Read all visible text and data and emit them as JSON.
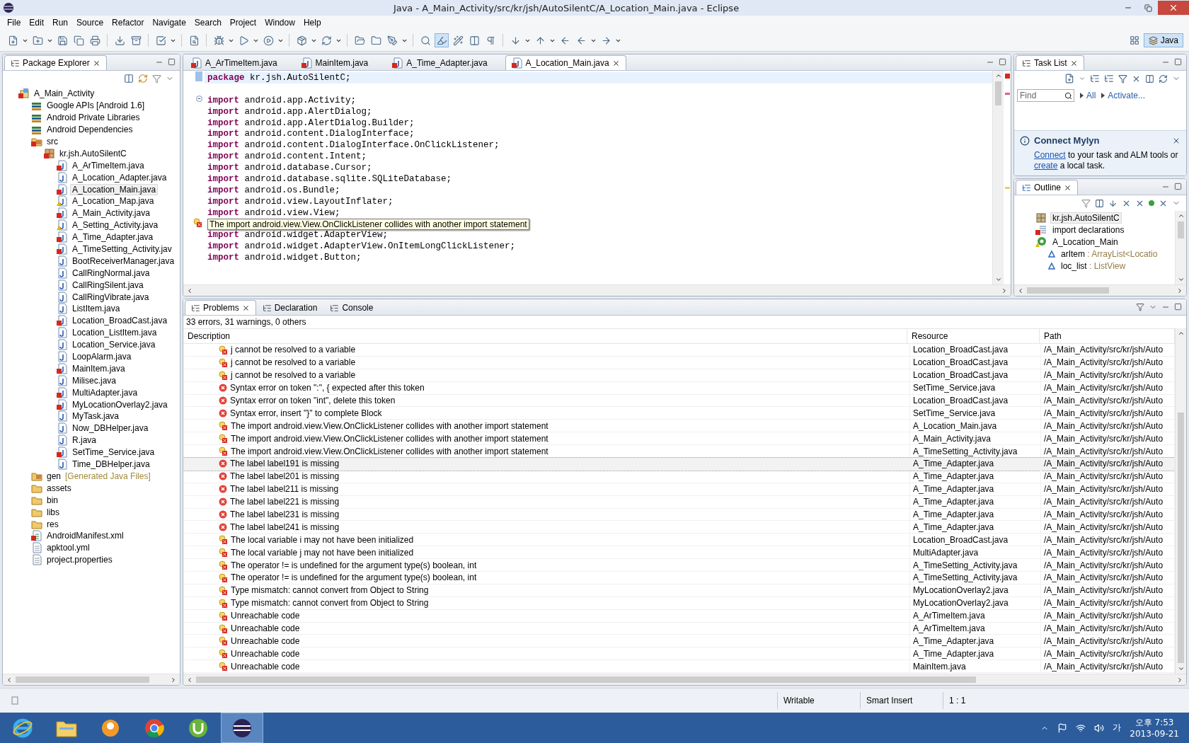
{
  "window": {
    "title": "Java - A_Main_Activity/src/kr/jsh/AutoSilentC/A_Location_Main.java - Eclipse"
  },
  "menu": [
    "File",
    "Edit",
    "Run",
    "Source",
    "Refactor",
    "Navigate",
    "Search",
    "Project",
    "Window",
    "Help"
  ],
  "perspective": {
    "label": "Java",
    "selected": true
  },
  "package_explorer": {
    "title": "Package Explorer",
    "tree": [
      {
        "label": "A_Main_Activity",
        "kind": "project",
        "error": true,
        "selected": false,
        "children": [
          {
            "label": "Google APIs [Android 1.6]",
            "kind": "library",
            "selected": false
          },
          {
            "label": "Android Private Libraries",
            "kind": "library",
            "selected": false
          },
          {
            "label": "Android Dependencies",
            "kind": "library",
            "selected": false
          },
          {
            "label": "src",
            "kind": "srcfolder",
            "error": true,
            "selected": false,
            "children": [
              {
                "label": "kr.jsh.AutoSilentC",
                "kind": "package",
                "error": true,
                "selected": false,
                "children": [
                  {
                    "label": "A_ArTimeItem.java",
                    "kind": "java",
                    "error": true,
                    "selected": false
                  },
                  {
                    "label": "A_Location_Adapter.java",
                    "kind": "java",
                    "selected": false
                  },
                  {
                    "label": "A_Location_Main.java",
                    "kind": "java",
                    "error": true,
                    "selected": true
                  },
                  {
                    "label": "A_Location_Map.java",
                    "kind": "java",
                    "warning": true,
                    "selected": false
                  },
                  {
                    "label": "A_Main_Activity.java",
                    "kind": "java",
                    "error": true,
                    "selected": false
                  },
                  {
                    "label": "A_Setting_Activity.java",
                    "kind": "java",
                    "warning": true,
                    "selected": false
                  },
                  {
                    "label": "A_Time_Adapter.java",
                    "kind": "java",
                    "error": true,
                    "selected": false
                  },
                  {
                    "label": "A_TimeSetting_Activity.jav",
                    "kind": "java",
                    "error": true,
                    "selected": false
                  },
                  {
                    "label": "BootReceiverManager.java",
                    "kind": "java",
                    "selected": false
                  },
                  {
                    "label": "CallRingNormal.java",
                    "kind": "java",
                    "selected": false
                  },
                  {
                    "label": "CallRingSilent.java",
                    "kind": "java",
                    "selected": false
                  },
                  {
                    "label": "CallRingVibrate.java",
                    "kind": "java",
                    "selected": false
                  },
                  {
                    "label": "ListItem.java",
                    "kind": "java",
                    "selected": false
                  },
                  {
                    "label": "Location_BroadCast.java",
                    "kind": "java",
                    "error": true,
                    "selected": false
                  },
                  {
                    "label": "Location_ListItem.java",
                    "kind": "java",
                    "selected": false
                  },
                  {
                    "label": "Location_Service.java",
                    "kind": "java",
                    "selected": false
                  },
                  {
                    "label": "LoopAlarm.java",
                    "kind": "java",
                    "selected": false
                  },
                  {
                    "label": "MainItem.java",
                    "kind": "java",
                    "error": true,
                    "selected": false
                  },
                  {
                    "label": "Milisec.java",
                    "kind": "java",
                    "selected": false
                  },
                  {
                    "label": "MultiAdapter.java",
                    "kind": "java",
                    "error": true,
                    "selected": false
                  },
                  {
                    "label": "MyLocationOverlay2.java",
                    "kind": "java",
                    "error": true,
                    "selected": false
                  },
                  {
                    "label": "MyTask.java",
                    "kind": "java",
                    "selected": false
                  },
                  {
                    "label": "Now_DBHelper.java",
                    "kind": "java",
                    "selected": false
                  },
                  {
                    "label": "R.java",
                    "kind": "java",
                    "selected": false
                  },
                  {
                    "label": "SetTime_Service.java",
                    "kind": "java",
                    "error": true,
                    "selected": false
                  },
                  {
                    "label": "Time_DBHelper.java",
                    "kind": "java",
                    "selected": false
                  }
                ]
              }
            ]
          },
          {
            "label": "gen",
            "decoration": "[Generated Java Files]",
            "kind": "srcfolder",
            "selected": false
          },
          {
            "label": "assets",
            "kind": "folder",
            "selected": false
          },
          {
            "label": "bin",
            "kind": "folder",
            "selected": false
          },
          {
            "label": "libs",
            "kind": "folder",
            "selected": false
          },
          {
            "label": "res",
            "kind": "folder",
            "selected": false
          },
          {
            "label": "AndroidManifest.xml",
            "kind": "manifest",
            "error": true,
            "selected": false
          },
          {
            "label": "apktool.yml",
            "kind": "file",
            "selected": false
          },
          {
            "label": "project.properties",
            "kind": "file",
            "selected": false
          }
        ]
      }
    ]
  },
  "editor": {
    "tabs": [
      {
        "label": "A_ArTimeItem.java",
        "selected": false
      },
      {
        "label": "MainItem.java",
        "selected": false
      },
      {
        "label": "A_Time_Adapter.java",
        "selected": false
      },
      {
        "label": "A_Location_Main.java",
        "selected": true
      }
    ],
    "lines": [
      {
        "kind": "statement",
        "keyword": "package",
        "rest": "kr.jsh.AutoSilentC;",
        "current": true
      },
      {
        "kind": "blank",
        "current": false
      },
      {
        "kind": "statement",
        "keyword": "import",
        "rest": "android.app.Activity;",
        "folding": true,
        "current": false
      },
      {
        "kind": "statement",
        "keyword": "import",
        "rest": "android.app.AlertDialog;",
        "current": false
      },
      {
        "kind": "statement",
        "keyword": "import",
        "rest": "android.app.AlertDialog.Builder;",
        "current": false
      },
      {
        "kind": "statement",
        "keyword": "import",
        "rest": "android.content.DialogInterface;",
        "current": false
      },
      {
        "kind": "statement",
        "keyword": "import",
        "rest": "android.content.DialogInterface.OnClickListener;",
        "current": false
      },
      {
        "kind": "statement",
        "keyword": "import",
        "rest": "android.content.Intent;",
        "current": false
      },
      {
        "kind": "statement",
        "keyword": "import",
        "rest": "android.database.Cursor;",
        "current": false
      },
      {
        "kind": "statement",
        "keyword": "import",
        "rest": "android.database.sqlite.SQLiteDatabase;",
        "current": false
      },
      {
        "kind": "statement",
        "keyword": "import",
        "rest": "android.os.Bundle;",
        "current": false
      },
      {
        "kind": "statement",
        "keyword": "import",
        "rest": "android.view.LayoutInflater;",
        "current": false
      },
      {
        "kind": "statement",
        "keyword": "import",
        "rest": "android.view.View;",
        "current": false
      },
      {
        "kind": "tooltip",
        "text": "The import android.view.View.OnClickListener collides with another import statement",
        "current": false
      },
      {
        "kind": "statement",
        "keyword": "import",
        "rest": "android.widget.AdapterView;",
        "current": false
      },
      {
        "kind": "statement",
        "keyword": "import",
        "rest": "android.widget.AdapterView.OnItemLongClickListener;",
        "current": false
      },
      {
        "kind": "statement",
        "keyword": "import",
        "rest": "android.widget.Button;",
        "current": false
      }
    ]
  },
  "task_list": {
    "title": "Task List",
    "find_placeholder": "Find",
    "filters": [
      "All",
      "Activate..."
    ],
    "mylyn": {
      "title": "Connect Mylyn",
      "parts": [
        {
          "text": "Connect",
          "link": true
        },
        {
          "text": " to your task and ALM tools or ",
          "link": false
        },
        {
          "text": "create",
          "link": true
        },
        {
          "text": " a local task.",
          "link": false
        }
      ]
    }
  },
  "outline": {
    "title": "Outline",
    "items": [
      {
        "kind": "package",
        "name": "kr.jsh.AutoSilentC",
        "selected": true
      },
      {
        "kind": "imports",
        "name": "import declarations",
        "selected": false
      },
      {
        "kind": "class",
        "name": "A_Location_Main",
        "selected": false,
        "children": [
          {
            "kind": "field",
            "name": "arItem",
            "type": ": ArrayList<Locatio",
            "selected": false
          },
          {
            "kind": "field",
            "name": "loc_list",
            "type": ": ListView",
            "selected": false
          }
        ]
      }
    ]
  },
  "problems": {
    "tabs": [
      {
        "label": "Problems",
        "selected": true
      },
      {
        "label": "Declaration",
        "selected": false
      },
      {
        "label": "Console",
        "selected": false
      }
    ],
    "summary": "33 errors, 31 warnings, 0 others",
    "columns": [
      "Description",
      "Resource",
      "Path"
    ],
    "rows": [
      {
        "kind": "quickfix",
        "description": "j cannot be resolved to a variable",
        "resource": "Location_BroadCast.java",
        "path": "/A_Main_Activity/src/kr/jsh/Auto",
        "selected": false
      },
      {
        "kind": "quickfix",
        "description": "j cannot be resolved to a variable",
        "resource": "Location_BroadCast.java",
        "path": "/A_Main_Activity/src/kr/jsh/Auto",
        "selected": false
      },
      {
        "kind": "quickfix",
        "description": "j cannot be resolved to a variable",
        "resource": "Location_BroadCast.java",
        "path": "/A_Main_Activity/src/kr/jsh/Auto",
        "selected": false
      },
      {
        "kind": "error",
        "description": "Syntax error on token \":\", { expected after this token",
        "resource": "SetTime_Service.java",
        "path": "/A_Main_Activity/src/kr/jsh/Auto",
        "selected": false
      },
      {
        "kind": "error",
        "description": "Syntax error on token \"int\", delete this token",
        "resource": "Location_BroadCast.java",
        "path": "/A_Main_Activity/src/kr/jsh/Auto",
        "selected": false
      },
      {
        "kind": "error",
        "description": "Syntax error, insert \"}\" to complete Block",
        "resource": "SetTime_Service.java",
        "path": "/A_Main_Activity/src/kr/jsh/Auto",
        "selected": false
      },
      {
        "kind": "quickfix",
        "description": "The import android.view.View.OnClickListener collides with another import statement",
        "resource": "A_Location_Main.java",
        "path": "/A_Main_Activity/src/kr/jsh/Auto",
        "selected": false
      },
      {
        "kind": "quickfix",
        "description": "The import android.view.View.OnClickListener collides with another import statement",
        "resource": "A_Main_Activity.java",
        "path": "/A_Main_Activity/src/kr/jsh/Auto",
        "selected": false
      },
      {
        "kind": "quickfix",
        "description": "The import android.view.View.OnClickListener collides with another import statement",
        "resource": "A_TimeSetting_Activity.java",
        "path": "/A_Main_Activity/src/kr/jsh/Auto",
        "selected": false
      },
      {
        "kind": "error",
        "description": "The label label191 is missing",
        "resource": "A_Time_Adapter.java",
        "path": "/A_Main_Activity/src/kr/jsh/Auto",
        "selected": true
      },
      {
        "kind": "error",
        "description": "The label label201 is missing",
        "resource": "A_Time_Adapter.java",
        "path": "/A_Main_Activity/src/kr/jsh/Auto",
        "selected": false
      },
      {
        "kind": "error",
        "description": "The label label211 is missing",
        "resource": "A_Time_Adapter.java",
        "path": "/A_Main_Activity/src/kr/jsh/Auto",
        "selected": false
      },
      {
        "kind": "error",
        "description": "The label label221 is missing",
        "resource": "A_Time_Adapter.java",
        "path": "/A_Main_Activity/src/kr/jsh/Auto",
        "selected": false
      },
      {
        "kind": "error",
        "description": "The label label231 is missing",
        "resource": "A_Time_Adapter.java",
        "path": "/A_Main_Activity/src/kr/jsh/Auto",
        "selected": false
      },
      {
        "kind": "error",
        "description": "The label label241 is missing",
        "resource": "A_Time_Adapter.java",
        "path": "/A_Main_Activity/src/kr/jsh/Auto",
        "selected": false
      },
      {
        "kind": "quickfix",
        "description": "The local variable i may not have been initialized",
        "resource": "Location_BroadCast.java",
        "path": "/A_Main_Activity/src/kr/jsh/Auto",
        "selected": false
      },
      {
        "kind": "quickfix",
        "description": "The local variable j may not have been initialized",
        "resource": "MultiAdapter.java",
        "path": "/A_Main_Activity/src/kr/jsh/Auto",
        "selected": false
      },
      {
        "kind": "quickfix",
        "description": "The operator != is undefined for the argument type(s) boolean, int",
        "resource": "A_TimeSetting_Activity.java",
        "path": "/A_Main_Activity/src/kr/jsh/Auto",
        "selected": false
      },
      {
        "kind": "quickfix",
        "description": "The operator != is undefined for the argument type(s) boolean, int",
        "resource": "A_TimeSetting_Activity.java",
        "path": "/A_Main_Activity/src/kr/jsh/Auto",
        "selected": false
      },
      {
        "kind": "quickfix",
        "description": "Type mismatch: cannot convert from Object to String",
        "resource": "MyLocationOverlay2.java",
        "path": "/A_Main_Activity/src/kr/jsh/Auto",
        "selected": false
      },
      {
        "kind": "quickfix",
        "description": "Type mismatch: cannot convert from Object to String",
        "resource": "MyLocationOverlay2.java",
        "path": "/A_Main_Activity/src/kr/jsh/Auto",
        "selected": false
      },
      {
        "kind": "quickfix",
        "description": "Unreachable code",
        "resource": "A_ArTimeItem.java",
        "path": "/A_Main_Activity/src/kr/jsh/Auto",
        "selected": false
      },
      {
        "kind": "quickfix",
        "description": "Unreachable code",
        "resource": "A_ArTimeItem.java",
        "path": "/A_Main_Activity/src/kr/jsh/Auto",
        "selected": false
      },
      {
        "kind": "quickfix",
        "description": "Unreachable code",
        "resource": "A_Time_Adapter.java",
        "path": "/A_Main_Activity/src/kr/jsh/Auto",
        "selected": false
      },
      {
        "kind": "quickfix",
        "description": "Unreachable code",
        "resource": "A_Time_Adapter.java",
        "path": "/A_Main_Activity/src/kr/jsh/Auto",
        "selected": false
      },
      {
        "kind": "quickfix",
        "description": "Unreachable code",
        "resource": "MainItem.java",
        "path": "/A_Main_Activity/src/kr/jsh/Auto",
        "selected": false
      }
    ]
  },
  "status_bar": {
    "fields": [
      "Writable",
      "Smart Insert",
      "1 : 1"
    ]
  },
  "taskbar": {
    "ime": "가",
    "time": "오후 7:53",
    "date": "2013-09-21"
  }
}
